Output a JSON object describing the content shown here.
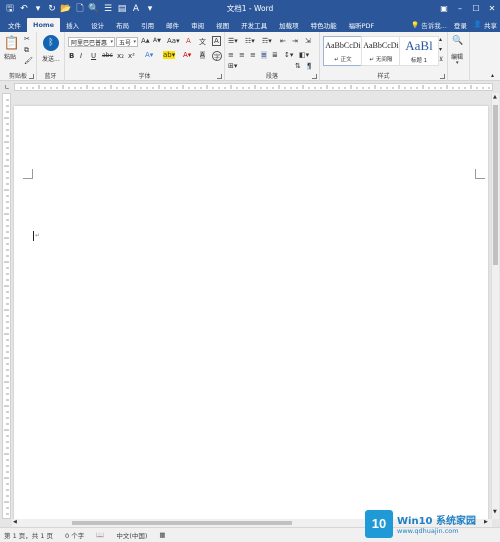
{
  "window": {
    "title": "文档1 - Word",
    "controls": [
      "restore-icon",
      "minimize-icon",
      "maximize-icon",
      "close-icon"
    ]
  },
  "quick_access": {
    "items": [
      {
        "name": "save",
        "glyph": "🖫"
      },
      {
        "name": "undo",
        "glyph": "↶"
      },
      {
        "name": "dropdown",
        "glyph": "▾"
      },
      {
        "name": "redo",
        "glyph": "↻"
      },
      {
        "name": "open",
        "glyph": "📂"
      },
      {
        "name": "new-document",
        "glyph": "🗋"
      },
      {
        "name": "print-preview",
        "glyph": "🔍"
      },
      {
        "name": "list",
        "glyph": "☰"
      },
      {
        "name": "format",
        "glyph": "▤"
      },
      {
        "name": "font-color",
        "glyph": "A"
      },
      {
        "name": "more",
        "glyph": "▾"
      }
    ]
  },
  "tabs": [
    {
      "label": "文件",
      "active": false
    },
    {
      "label": "Home",
      "active": true
    },
    {
      "label": "插入",
      "active": false
    },
    {
      "label": "设计",
      "active": false
    },
    {
      "label": "布局",
      "active": false
    },
    {
      "label": "引用",
      "active": false
    },
    {
      "label": "邮件",
      "active": false
    },
    {
      "label": "审阅",
      "active": false
    },
    {
      "label": "视图",
      "active": false
    },
    {
      "label": "开发工具",
      "active": false
    },
    {
      "label": "加载项",
      "active": false
    },
    {
      "label": "特色功能",
      "active": false
    },
    {
      "label": "福昕PDF",
      "active": false
    }
  ],
  "tab_right": {
    "tell_me": "告诉我...",
    "login": "登录",
    "share": "共享"
  },
  "ribbon": {
    "clipboard": {
      "paste": "粘贴",
      "label": "剪贴板"
    },
    "bluetooth": {
      "send": "发送...",
      "label": "蓝牙"
    },
    "font": {
      "name": "阿里巴巴普惠",
      "size": "五号",
      "label": "字体",
      "buttons": [
        "B",
        "I",
        "U",
        "abc",
        "x₂",
        "x²"
      ]
    },
    "paragraph": {
      "label": "段落"
    },
    "styles": {
      "label": "样式",
      "items": [
        {
          "sample": "AaBbCcDi",
          "name": "↵ 正文",
          "selected": true
        },
        {
          "sample": "AaBbCcDi",
          "name": "↵ 无间隔",
          "selected": false
        },
        {
          "sample": "AaBl",
          "name": "标题 1",
          "selected": false
        }
      ]
    },
    "editing": {
      "label": "编辑"
    }
  },
  "document": {
    "paragraph_mark": "↵"
  },
  "status": {
    "page": "第 1 页，共 1 页",
    "words": "0 个字",
    "language": "中文(中国)"
  },
  "watermark": {
    "logo": "10",
    "name": "Win10 系统家园",
    "url": "www.qdhuajin.com"
  },
  "colors": {
    "word_blue": "#2b579a",
    "ribbon_bg": "#f3f3f3",
    "canvas_bg": "#e6e6e6"
  }
}
